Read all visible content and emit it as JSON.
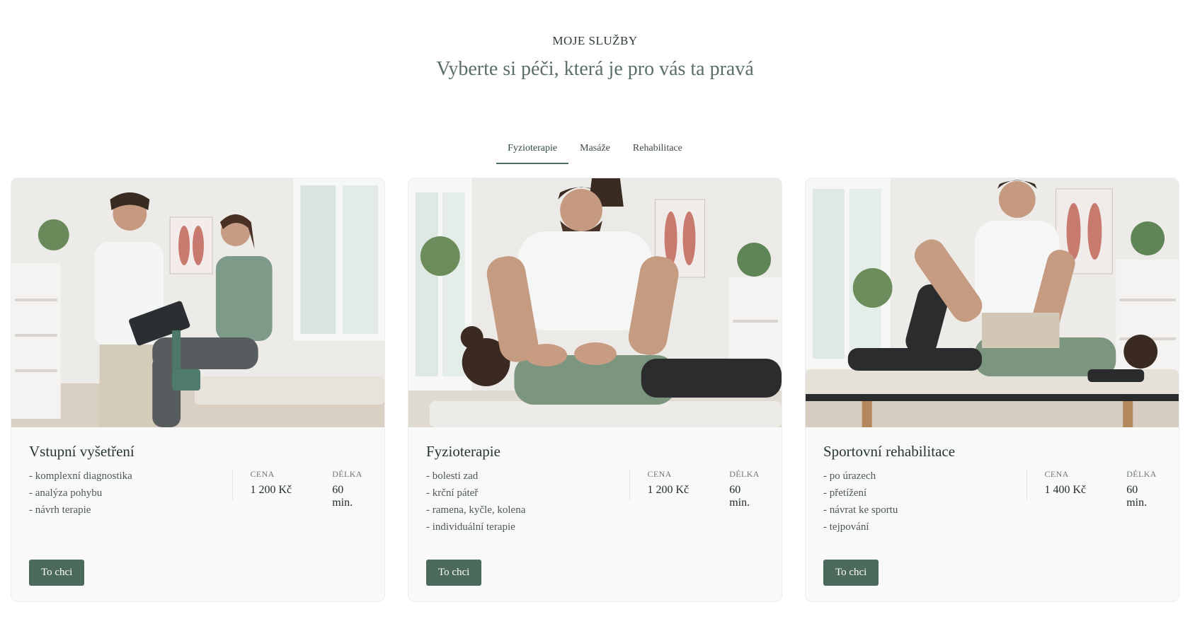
{
  "header": {
    "eyebrow": "MOJE SLUŽBY",
    "headline": "Vyberte si péči, která je pro vás ta pravá"
  },
  "tabs": [
    {
      "label": "Fyzioterapie",
      "active": true
    },
    {
      "label": "Masáže",
      "active": false
    },
    {
      "label": "Rehabilitace",
      "active": false
    }
  ],
  "cards": [
    {
      "title": "Vstupní vyšetření",
      "features": [
        "- komplexní diagnostika",
        "- analýza pohybu",
        "- návrh terapie"
      ],
      "price_label": "CENA",
      "price": "1 200 Kč",
      "duration_label": "DÉLKA",
      "duration": "60 min.",
      "cta": "To chci"
    },
    {
      "title": "Fyzioterapie",
      "features": [
        "- bolesti zad",
        "- krční páteř",
        "- ramena, kyčle, kolena",
        "- individuální terapie"
      ],
      "price_label": "CENA",
      "price": "1 200 Kč",
      "duration_label": "DÉLKA",
      "duration": "60 min.",
      "cta": "To chci"
    },
    {
      "title": "Sportovní rehabilitace",
      "features": [
        "- po úrazech",
        "- přetížení",
        "- návrat ke sportu",
        "- tejpování"
      ],
      "price_label": "CENA",
      "price": "1 400 Kč",
      "duration_label": "DÉLKA",
      "duration": "60 min.",
      "cta": "To chci"
    }
  ],
  "colors": {
    "accent": "#4b6a5c",
    "tab_underline": "#4d6a5d",
    "card_bg": "#f8f9f8"
  }
}
